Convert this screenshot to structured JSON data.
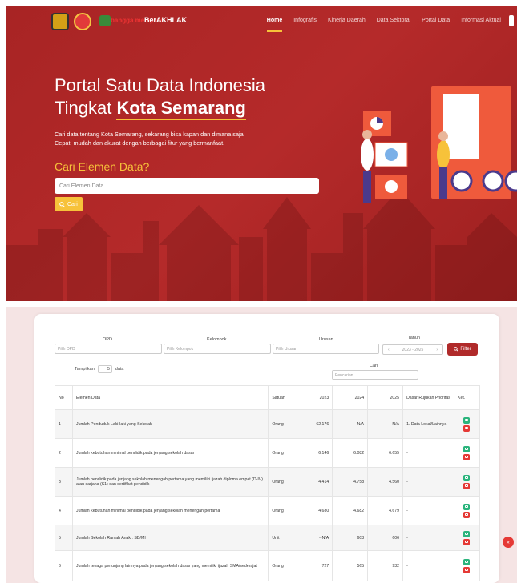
{
  "nav": {
    "logo_text1": "bangga melayani",
    "logo_text2": "BerAKHLAK",
    "items": [
      {
        "label": "Home",
        "active": true
      },
      {
        "label": "Infografis",
        "active": false
      },
      {
        "label": "Kinerja Daerah",
        "active": false
      },
      {
        "label": "Data Sektoral",
        "active": false
      },
      {
        "label": "Portal Data",
        "active": false
      },
      {
        "label": "Informasi Aktual",
        "active": false
      }
    ]
  },
  "hero": {
    "title_line1": "Portal Satu Data Indonesia",
    "title_line2_prefix": "Tingkat ",
    "title_line2_highlight": "Kota Semarang",
    "desc_line1": "Cari data tentang Kota Semarang, sekarang bisa kapan dan dimana saja.",
    "desc_line2": "Cepat, mudah dan akurat dengan berbagai fitur yang bermanfaat.",
    "search_heading": "Cari Elemen Data?",
    "search_placeholder": "Cari Elemen Data ...",
    "search_button": "Cari"
  },
  "filters": {
    "opd_label": "OPD",
    "opd_placeholder": "Pilih OPD",
    "kelompok_label": "Kelompok",
    "kelompok_placeholder": "Pilih Kelompok",
    "urusan_label": "Urusan",
    "urusan_placeholder": "Pilih Urusan",
    "tahun_label": "Tahun",
    "tahun_range": "2023 - 2025",
    "filter_button": "Filter"
  },
  "table_controls": {
    "tampilkan_label": "Tampilkan",
    "page_size": "5",
    "data_label": "data",
    "cari_label": "Cari",
    "cari_placeholder": "Pencarian"
  },
  "table": {
    "headers": {
      "no": "No",
      "elemen": "Elemen Data",
      "satuan": "Satuan",
      "y2023": "2023",
      "y2024": "2024",
      "y2025": "2025",
      "dasar": "Dasar/Rujukan Prioritas",
      "ket": "Ket."
    },
    "rows": [
      {
        "no": "1",
        "elemen": "Jumlah Penduduk Laki-laki yang Sekolah",
        "satuan": "Orang",
        "y2023": "62.176",
        "y2024": "--N/A",
        "y2025": "--N/A",
        "dasar": "1. Data Lokal/Lainnya"
      },
      {
        "no": "2",
        "elemen": "Jumlah kebutuhan minimal pendidik pada jenjang sekolah dasar",
        "satuan": "Orang",
        "y2023": "6.146",
        "y2024": "6.082",
        "y2025": "6.655",
        "dasar": "-"
      },
      {
        "no": "3",
        "elemen": "Jumlah pendidik pada jenjang sekolah menengah pertama yang memiliki ijazah diploma empat (D-IV) atau sarjana (S1) dan sertifikat pendidik",
        "satuan": "Orang",
        "y2023": "4.414",
        "y2024": "4.758",
        "y2025": "4.560",
        "dasar": "-"
      },
      {
        "no": "4",
        "elemen": "Jumlah kebutuhan minimal pendidik pada jenjang sekolah menengah pertama",
        "satuan": "Orang",
        "y2023": "4.680",
        "y2024": "4.682",
        "y2025": "4.679",
        "dasar": "-"
      },
      {
        "no": "5",
        "elemen": "Jumlah Sekolah Ramah Anak : SD/MI",
        "satuan": "Unit",
        "y2023": "--N/A",
        "y2024": "603",
        "y2025": "606",
        "dasar": "-"
      },
      {
        "no": "6",
        "elemen": "Jumlah tenaga penunjang lainnya pada jenjang sekolah dasar yang memiliki ijazah SMA/sederajat",
        "satuan": "Orang",
        "y2023": "727",
        "y2024": "565",
        "y2025": "932",
        "dasar": "-"
      }
    ]
  },
  "colors": {
    "primary": "#b02a2a",
    "accent": "#f7c23a",
    "value_red": "#d32f2f"
  }
}
